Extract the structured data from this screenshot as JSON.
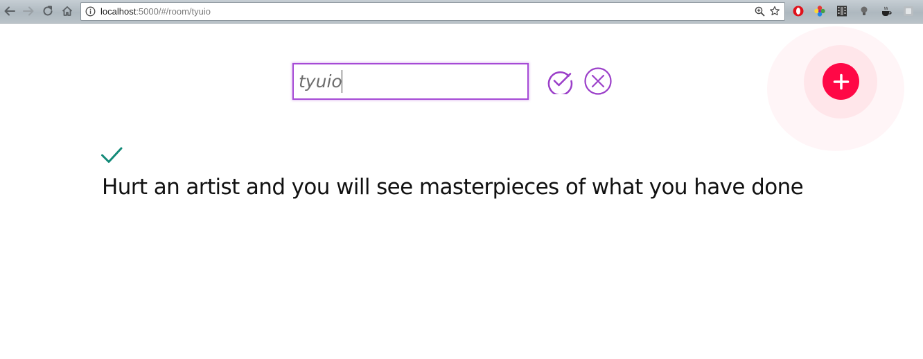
{
  "browser": {
    "url_host": "localhost",
    "url_path": ":5000/#/room/tyuio",
    "nav_icons": [
      "back-arrow-icon",
      "forward-arrow-icon",
      "reload-icon",
      "home-icon"
    ],
    "omnibox_icons": [
      "info-icon",
      "zoom-icon",
      "star-icon"
    ],
    "extension_icons": [
      "opera-extension-icon",
      "color-picker-extension-icon",
      "film-extension-icon",
      "lightbulb-extension-icon",
      "coffee-extension-icon",
      "puzzle-extension-icon"
    ]
  },
  "editor": {
    "input_value": "tyuio",
    "confirm_icon": "check-circle-icon",
    "cancel_icon": "close-circle-icon",
    "accent_color": "#a64ad6"
  },
  "fab": {
    "icon": "plus-icon",
    "color": "#ff0846"
  },
  "item": {
    "status_icon": "checkmark-icon",
    "status_color": "#128a78",
    "text": "Hurt an artist and you will see masterpieces of what you have done"
  }
}
